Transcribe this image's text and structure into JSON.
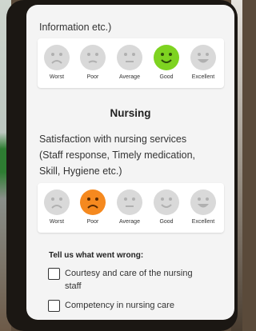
{
  "food_section": {
    "question_tail": "Information etc.)",
    "rating_labels": [
      "Worst",
      "Poor",
      "Average",
      "Good",
      "Excellent"
    ],
    "selected": "Good",
    "selected_color": "#7ed321"
  },
  "nursing_section": {
    "title": "Nursing",
    "question_line1": "Satisfaction with nursing services",
    "question_line2": "(Staff response, Timely medication,",
    "question_line3": "Skill, Hygiene etc.)",
    "rating_labels": [
      "Worst",
      "Poor",
      "Average",
      "Good",
      "Excellent"
    ],
    "selected": "Poor",
    "selected_color": "#f5891f"
  },
  "feedback": {
    "prompt": "Tell us what went wrong:",
    "options": [
      {
        "label": "Courtesy and care of the nursing staff",
        "checked": false
      },
      {
        "label": "Competency in nursing care",
        "checked": false
      }
    ]
  },
  "colors": {
    "unselected_face": "#d9d9d9",
    "screen_background": "#f4f4f4"
  }
}
